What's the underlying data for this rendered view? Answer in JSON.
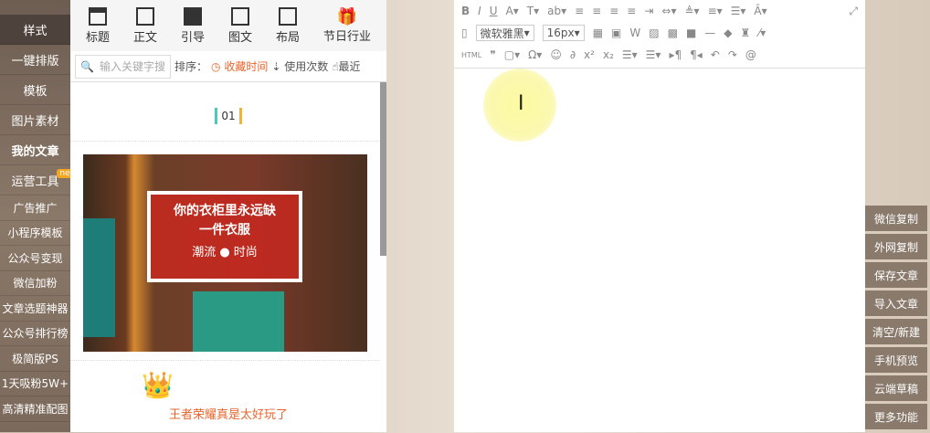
{
  "sidebar": {
    "items": [
      "样式",
      "一键排版",
      "模板",
      "图片素材",
      "我的文章",
      "运营工具",
      "广告推广",
      "小程序模板",
      "公众号变现",
      "微信加粉",
      "文章选题神器",
      "公众号排行榜",
      "极简版PS",
      "1天吸粉5W+",
      "高清精准配图"
    ],
    "new_badge": "new"
  },
  "categories": [
    "标题",
    "正文",
    "引导",
    "图文",
    "布局",
    "节日行业"
  ],
  "search": {
    "placeholder": "输入关键字搜"
  },
  "sort": {
    "label": "排序：",
    "options": [
      "收藏时间",
      "使用次数",
      "最近"
    ]
  },
  "templates": {
    "number": "01",
    "headline1": "你的衣柜里永远缺",
    "headline2": "一件衣服",
    "sub": "潮流 ● 时尚",
    "caption": "王者荣耀真是太好玩了"
  },
  "editor": {
    "font": "微软雅黑",
    "size": "16px",
    "html": "HTML"
  },
  "right_buttons": [
    "微信复制",
    "外网复制",
    "保存文章",
    "导入文章",
    "清空/新建",
    "手机预览",
    "云端草稿",
    "更多功能"
  ]
}
